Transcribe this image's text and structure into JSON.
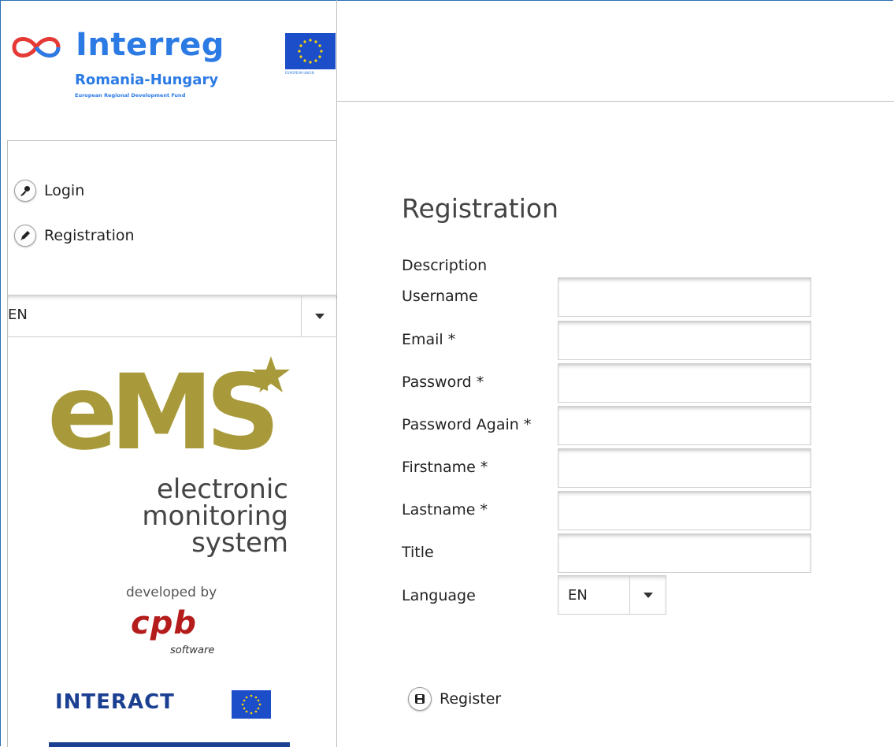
{
  "header": {
    "program_name": "Interreg",
    "program_region": "Romania-Hungary",
    "program_fund": "European Regional Development Fund",
    "eu_caption": "EUROPEAN UNION"
  },
  "sidebar": {
    "nav": [
      {
        "label": "Login",
        "icon": "key-icon"
      },
      {
        "label": "Registration",
        "icon": "pencil-icon"
      }
    ],
    "language_select": {
      "value": "EN"
    },
    "ems_logo": {
      "letters": "eMS",
      "line1": "electronic",
      "line2": "monitoring",
      "line3": "system",
      "developed_by": "developed by",
      "company": "cpb",
      "company_sub": "software"
    },
    "interact_logo": "INTERACT"
  },
  "form": {
    "title": "Registration",
    "description_label": "Description",
    "fields": [
      {
        "label": "Username",
        "value": ""
      },
      {
        "label": "Email *",
        "value": ""
      },
      {
        "label": "Password *",
        "value": ""
      },
      {
        "label": "Password Again *",
        "value": ""
      },
      {
        "label": "Firstname *",
        "value": ""
      },
      {
        "label": "Lastname *",
        "value": ""
      },
      {
        "label": "Title",
        "value": ""
      }
    ],
    "language_label": "Language",
    "language_value": "EN",
    "register_label": "Register"
  },
  "colors": {
    "interreg_blue": "#2c7be5",
    "eu_blue": "#1d4ec9",
    "ems_olive": "#a89a3a",
    "cpb_red": "#b51c1c",
    "interact_navy": "#1b3f91"
  }
}
